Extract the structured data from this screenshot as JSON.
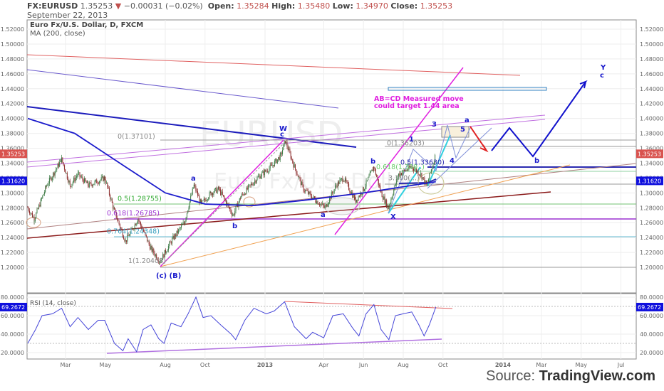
{
  "header": {
    "symbol": "FX:EURUSD",
    "last": "1.35253",
    "change": "−0.00031 (−0.02%)",
    "open_label": "Open:",
    "open": "1.35284",
    "high_label": "High:",
    "high": "1.35480",
    "low_label": "Low:",
    "low": "1.34970",
    "close_label": "Close:",
    "close": "1.35253",
    "date": "September 22, 2013"
  },
  "legend": {
    "title": "Euro Fx/U.S. Dollar, D, FXCM",
    "ma": "MA (200, close)",
    "rsi": "RSI (14, close)"
  },
  "watermark": {
    "symbol": "EURUSD",
    "name": "Euro Fx/U.S. Dollar"
  },
  "source": {
    "prefix": "Source: ",
    "site": "TradingView.com"
  },
  "colors": {
    "up": "#3d7a45",
    "down": "#8c2c2c",
    "ma": "#1c1ccc",
    "rsi": "#4646d8",
    "accent_red": "#d9534f",
    "accent_blue": "#1010dd"
  },
  "chart_data": {
    "type": "line",
    "title": "Euro Fx/U.S. Dollar, D, FXCM",
    "ylim": [
      1.18,
      1.53
    ],
    "yticks": [
      "1.52000",
      "1.50000",
      "1.48000",
      "1.46000",
      "1.44000",
      "1.42000",
      "1.40000",
      "1.38000",
      "1.36000",
      "1.34000",
      "1.32000",
      "1.30000",
      "1.28000",
      "1.26000",
      "1.24000",
      "1.22000",
      "1.20000"
    ],
    "xticks": [
      {
        "d": "2012-03-01",
        "l": "Mar"
      },
      {
        "d": "2012-05-01",
        "l": "May"
      },
      {
        "d": "2012-08-01",
        "l": "Aug"
      },
      {
        "d": "2012-10-01",
        "l": "Oct"
      },
      {
        "d": "2013-01-01",
        "l": "2013"
      },
      {
        "d": "2013-04-01",
        "l": "Apr"
      },
      {
        "d": "2013-06-01",
        "l": "Jun"
      },
      {
        "d": "2013-08-01",
        "l": "Aug"
      },
      {
        "d": "2013-10-01",
        "l": "Oct"
      },
      {
        "d": "2014-01-01",
        "l": "2014"
      },
      {
        "d": "2014-03-01",
        "l": "Mar"
      },
      {
        "d": "2014-05-01",
        "l": "May"
      },
      {
        "d": "2014-07-01",
        "l": "Jul"
      }
    ],
    "price": [
      [
        "2012-01-03",
        1.28
      ],
      [
        "2012-01-13",
        1.265
      ],
      [
        "2012-02-01",
        1.31
      ],
      [
        "2012-02-24",
        1.345
      ],
      [
        "2012-03-08",
        1.31
      ],
      [
        "2012-03-20",
        1.325
      ],
      [
        "2012-04-05",
        1.31
      ],
      [
        "2012-04-30",
        1.32
      ],
      [
        "2012-05-15",
        1.275
      ],
      [
        "2012-06-01",
        1.235
      ],
      [
        "2012-06-20",
        1.265
      ],
      [
        "2012-07-10",
        1.225
      ],
      [
        "2012-07-24",
        1.208
      ],
      [
        "2012-08-10",
        1.235
      ],
      [
        "2012-08-30",
        1.26
      ],
      [
        "2012-09-14",
        1.31
      ],
      [
        "2012-09-25",
        1.285
      ],
      [
        "2012-10-10",
        1.3
      ],
      [
        "2012-10-22",
        1.305
      ],
      [
        "2012-11-13",
        1.27
      ],
      [
        "2012-11-25",
        1.295
      ],
      [
        "2012-12-20",
        1.32
      ],
      [
        "2013-01-10",
        1.335
      ],
      [
        "2013-01-25",
        1.35
      ],
      [
        "2013-02-01",
        1.37
      ],
      [
        "2013-02-15",
        1.335
      ],
      [
        "2013-03-01",
        1.305
      ],
      [
        "2013-03-20",
        1.29
      ],
      [
        "2013-04-03",
        1.28
      ],
      [
        "2013-04-20",
        1.31
      ],
      [
        "2013-05-01",
        1.32
      ],
      [
        "2013-05-20",
        1.29
      ],
      [
        "2013-06-01",
        1.305
      ],
      [
        "2013-06-17",
        1.335
      ],
      [
        "2013-06-28",
        1.3
      ],
      [
        "2013-07-09",
        1.28
      ],
      [
        "2013-07-25",
        1.325
      ],
      [
        "2013-08-14",
        1.335
      ],
      [
        "2013-08-28",
        1.325
      ],
      [
        "2013-09-06",
        1.31
      ],
      [
        "2013-09-20",
        1.3525
      ]
    ],
    "ma200": [
      [
        "2012-01-03",
        1.4
      ],
      [
        "2012-03-15",
        1.38
      ],
      [
        "2012-06-01",
        1.335
      ],
      [
        "2012-08-01",
        1.3
      ],
      [
        "2012-10-01",
        1.285
      ],
      [
        "2012-12-15",
        1.283
      ],
      [
        "2013-03-01",
        1.29
      ],
      [
        "2013-06-01",
        1.3
      ],
      [
        "2013-09-20",
        1.315
      ]
    ],
    "price_tags": [
      {
        "label": "1.35253",
        "value": 1.35253,
        "color": "#d9534f"
      },
      {
        "label": "1.31620",
        "value": 1.3162,
        "color": "#1010dd"
      }
    ],
    "fib_labels": [
      {
        "text": "0(1.37101)",
        "value": 1.37101
      },
      {
        "text": "0.5(1.28755)",
        "value": 1.28755
      },
      {
        "text": "0.618(1.26785)",
        "value": 1.26785
      },
      {
        "text": "0.764(1.24348)",
        "value": 1.24348
      },
      {
        "text": "1(1.20408)",
        "value": 1.20408
      },
      {
        "text": "0(1.36203)",
        "value": 1.36203
      },
      {
        "text": "0.5(1.33630)",
        "value": 1.3363
      },
      {
        "text": "0.618(1.330..)",
        "value": 1.33
      },
      {
        "text": "3.100(...)",
        "value": 1.315
      }
    ],
    "wave_labels": [
      "W",
      "c",
      "a",
      "b",
      "(c) (B)",
      "a",
      "b",
      "1",
      "3",
      "4",
      "5",
      "a",
      "X",
      "b",
      "Y",
      "c"
    ],
    "annotation": [
      "AB=CD Measured move",
      "could target 1.44 area"
    ],
    "rsi": {
      "ylim": [
        15,
        85
      ],
      "yticks": [
        "80.0000",
        "60.0000",
        "40.0000",
        "20.0000"
      ],
      "last": "69.2672",
      "last_value": 69.2672,
      "values": [
        [
          "2012-01-03",
          30
        ],
        [
          "2012-01-15",
          45
        ],
        [
          "2012-01-25",
          60
        ],
        [
          "2012-02-10",
          62
        ],
        [
          "2012-02-24",
          68
        ],
        [
          "2012-03-08",
          48
        ],
        [
          "2012-03-20",
          58
        ],
        [
          "2012-04-05",
          45
        ],
        [
          "2012-04-20",
          55
        ],
        [
          "2012-04-30",
          55
        ],
        [
          "2012-05-15",
          30
        ],
        [
          "2012-05-28",
          22
        ],
        [
          "2012-06-05",
          35
        ],
        [
          "2012-06-18",
          21
        ],
        [
          "2012-06-28",
          45
        ],
        [
          "2012-07-10",
          50
        ],
        [
          "2012-07-22",
          35
        ],
        [
          "2012-07-30",
          30
        ],
        [
          "2012-08-10",
          52
        ],
        [
          "2012-08-25",
          48
        ],
        [
          "2012-09-05",
          62
        ],
        [
          "2012-09-17",
          80
        ],
        [
          "2012-09-28",
          58
        ],
        [
          "2012-10-10",
          60
        ],
        [
          "2012-10-25",
          50
        ],
        [
          "2012-11-10",
          40
        ],
        [
          "2012-11-17",
          34
        ],
        [
          "2012-12-01",
          55
        ],
        [
          "2012-12-15",
          68
        ],
        [
          "2013-01-03",
          62
        ],
        [
          "2013-01-15",
          65
        ],
        [
          "2013-01-31",
          75
        ],
        [
          "2013-02-15",
          48
        ],
        [
          "2013-03-05",
          35
        ],
        [
          "2013-03-15",
          42
        ],
        [
          "2013-04-01",
          36
        ],
        [
          "2013-04-15",
          60
        ],
        [
          "2013-05-01",
          62
        ],
        [
          "2013-05-15",
          47
        ],
        [
          "2013-05-25",
          38
        ],
        [
          "2013-06-05",
          62
        ],
        [
          "2013-06-17",
          72
        ],
        [
          "2013-06-28",
          45
        ],
        [
          "2013-07-10",
          34
        ],
        [
          "2013-07-20",
          60
        ],
        [
          "2013-08-01",
          62
        ],
        [
          "2013-08-14",
          64
        ],
        [
          "2013-08-25",
          50
        ],
        [
          "2013-09-02",
          38
        ],
        [
          "2013-09-10",
          50
        ],
        [
          "2013-09-20",
          69.27
        ]
      ]
    }
  }
}
